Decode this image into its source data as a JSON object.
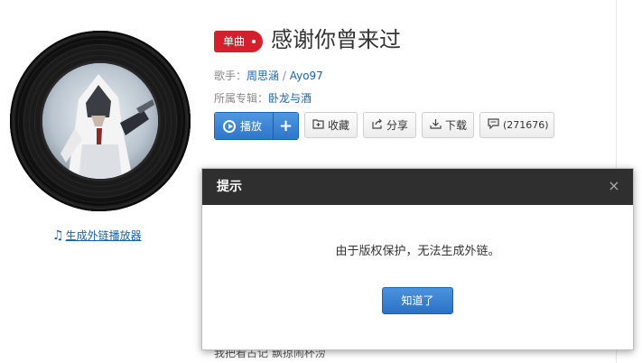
{
  "album_art": {
    "alt_icon": "album-cover-image"
  },
  "player_link": {
    "icon": "music-note-icon",
    "label": "生成外链播放器"
  },
  "song": {
    "badge": "单曲",
    "title": "感谢你曾来过",
    "singer_label": "歌手：",
    "singers": [
      "周思涵",
      "Ayo97"
    ],
    "singer_sep": " / ",
    "album_label": "所属专辑：",
    "album": "卧龙与酒"
  },
  "actions": {
    "play": "播放",
    "add": "+",
    "collect": "收藏",
    "share": "分享",
    "download": "下载",
    "comments": "(271676)"
  },
  "lyrics": {
    "partial_line": "我把看占记 飘掠闹杯涝"
  },
  "dialog": {
    "title": "提示",
    "close": "×",
    "message": "由于版权保护，无法生成外链。",
    "ok": "知道了"
  },
  "colors": {
    "accent_blue": "#2e76c9",
    "link_blue": "#1a62a8",
    "badge_red": "#d2212c",
    "dialog_header": "#2f2f2f"
  }
}
